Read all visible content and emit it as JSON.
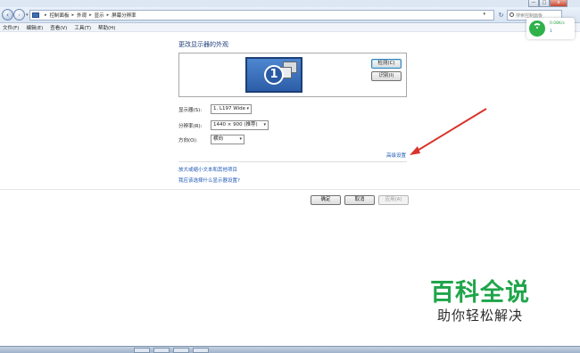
{
  "window": {
    "minimize_label": "—",
    "maximize_label": "□",
    "close_label": "x"
  },
  "address_bar": {
    "breadcrumbs": [
      "控制面板",
      "外观",
      "显示",
      "屏幕分辨率"
    ],
    "separator": "▸",
    "search_placeholder": "搜索控制面板"
  },
  "menu": {
    "items": [
      "文件(F)",
      "编辑(E)",
      "查看(V)",
      "工具(T)",
      "帮助(H)"
    ]
  },
  "network_widget": {
    "speed": "0.08K/s",
    "count": "1",
    "icon": "wifi-icon",
    "accent": "#2fb24a"
  },
  "main": {
    "title": "更改显示器的外观",
    "monitor_number": "1",
    "detect_label": "检测(C)",
    "identify_label": "识别(I)",
    "display_label": "显示器(S):",
    "display_value": "1. L197 Wide",
    "resolution_label": "分辨率(R):",
    "resolution_value": "1440 × 900 (推荐)",
    "orientation_label": "方向(O):",
    "orientation_value": "横向",
    "advanced_link": "高级设置",
    "link_text_size": "放大或缩小文本和其他项目",
    "link_which_setting": "我应该选择什么显示器设置?",
    "ok_label": "确定",
    "cancel_label": "取消",
    "apply_label": "应用(A)"
  },
  "watermark": {
    "title": "百科全说",
    "subtitle": "助你轻松解决",
    "color": "#1fa54a"
  },
  "annotation": {
    "arrow_color": "#d9342b"
  }
}
